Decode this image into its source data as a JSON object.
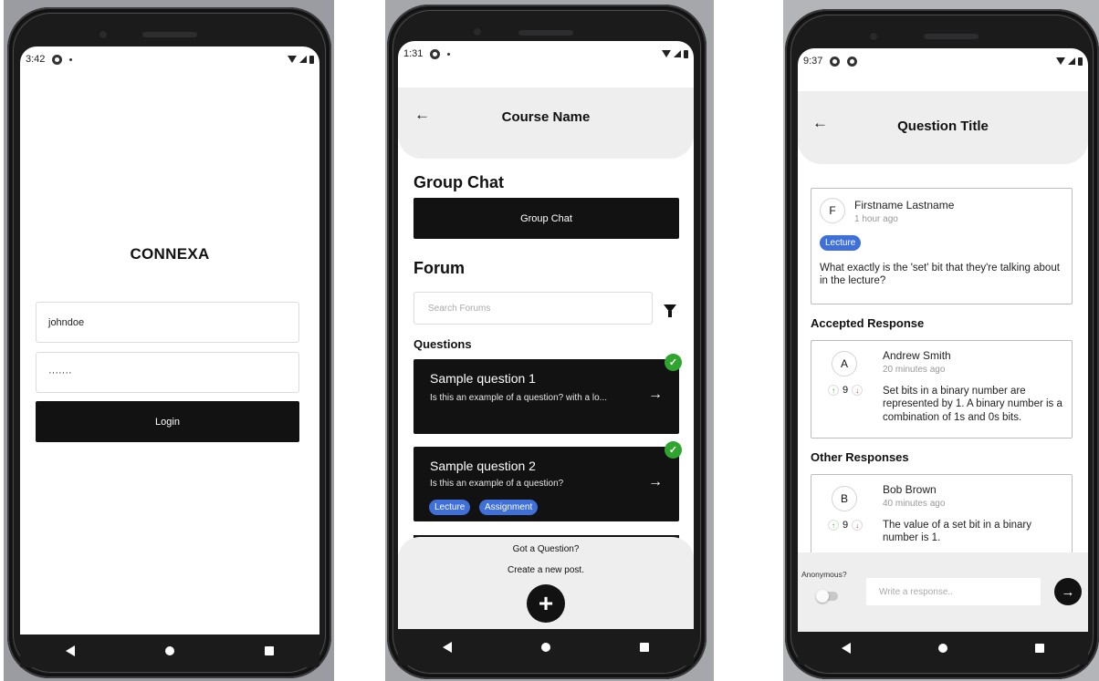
{
  "login_screen": {
    "status_time": "3:42",
    "brand": "CONNEXA",
    "username_value": "johndoe",
    "password_value": "·······",
    "login_label": "Login"
  },
  "course_screen": {
    "status_time": "1:31",
    "title": "Course Name",
    "group_chat_heading": "Group Chat",
    "group_chat_button": "Group Chat",
    "forum_heading": "Forum",
    "search_placeholder": "Search Forums",
    "questions_heading": "Questions",
    "questions": [
      {
        "title": "Sample question 1",
        "body": "Is this an example of a question? with a lo...",
        "answered": true,
        "tags": []
      },
      {
        "title": "Sample question 2",
        "body": "Is this an example of a question?",
        "answered": true,
        "tags": [
          "Lecture",
          "Assignment"
        ]
      }
    ],
    "cta_line1": "Got a Question?",
    "cta_line2": "Create a new post."
  },
  "question_screen": {
    "status_time": "9:37",
    "title": "Question Title",
    "question": {
      "avatar_letter": "F",
      "author": "Firstname Lastname",
      "time": "1 hour ago",
      "tag": "Lecture",
      "body": "What exactly is the 'set' bit that they're talking about in the lecture?"
    },
    "accepted_heading": "Accepted Response",
    "accepted": {
      "avatar_letter": "A",
      "author": "Andrew Smith",
      "time": "20 minutes ago",
      "votes": "9",
      "body": "Set bits in a binary number are represented by 1. A binary number is a combination of 1s and 0s bits."
    },
    "other_heading": "Other Responses",
    "other": [
      {
        "avatar_letter": "B",
        "author": "Bob Brown",
        "time": "40 minutes ago",
        "votes": "9",
        "body": "The value of a set bit in a binary number is 1."
      }
    ],
    "anonymous_label": "Anonymous?",
    "response_placeholder": "Write a response.."
  },
  "colors": {
    "dark_button": "#121212",
    "tag_blue": "#3f6fd8",
    "check_green": "#2fa52f",
    "header_grey": "#eeeeee"
  },
  "icons": [
    "back-arrow-icon",
    "right-arrow-icon",
    "filter-icon",
    "check-icon",
    "plus-icon",
    "upvote-icon",
    "downvote-icon",
    "send-icon",
    "nav-back-icon",
    "nav-home-icon",
    "nav-recent-icon"
  ]
}
